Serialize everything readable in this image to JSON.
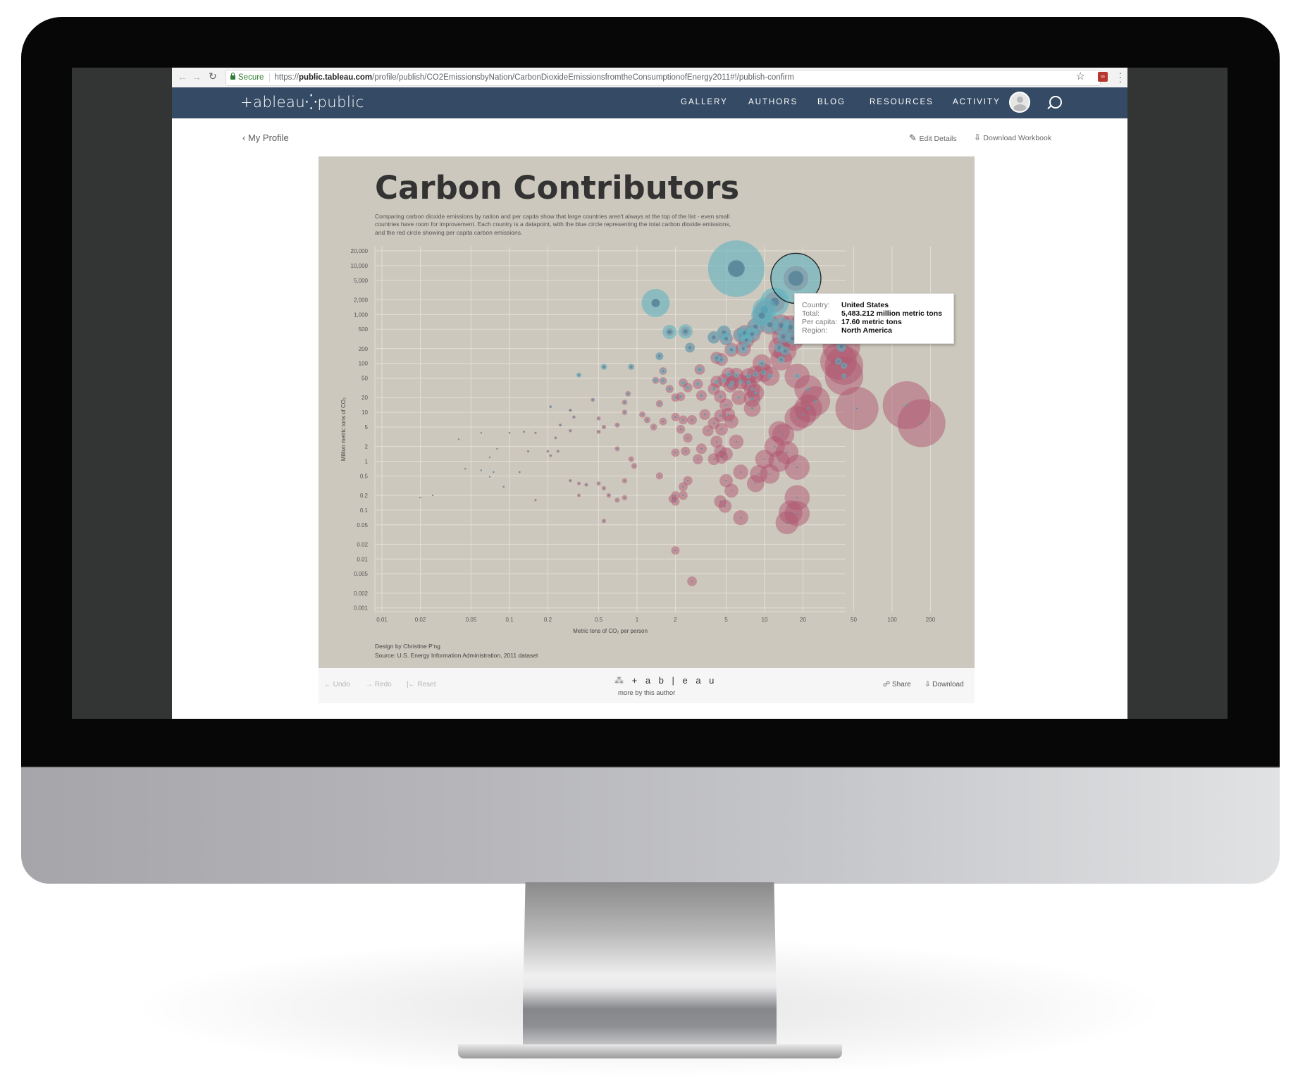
{
  "browser": {
    "secure_label": "Secure",
    "url_scheme": "https://",
    "url_host": "public.tableau.com",
    "url_path": "/profile/publish/CO2EmissionsbyNation/CarbonDioxideEmissionsfromtheConsumptionofEnergy2011#!/publish-confirm"
  },
  "site": {
    "logo": "+ableau⁛public",
    "nav": [
      "GALLERY",
      "AUTHORS",
      "BLOG",
      "RESOURCES",
      "ACTIVITY"
    ]
  },
  "subbar": {
    "back_label": "My Profile",
    "edit_label": "Edit Details",
    "download_workbook_label": "Download Workbook"
  },
  "dashboard": {
    "title": "Carbon Contributors",
    "description": "Comparing carbon dioxide emissions by nation and per capita show that large countries aren't always at the top of the list - even small countries have room for improvement. Each country is a datapoint, with the blue circle representing the total carbon dioxide emissions, and the red circle showing per capita carbon emissions.",
    "credit_design": "Design by Christine P'ng",
    "credit_source": "Source: U.S. Energy Information Administration, 2011 dataset",
    "colors": {
      "total": "#5fb3bf",
      "per_capita": "#b0566f",
      "background": "#ccc8bd"
    }
  },
  "tooltip": {
    "rows": [
      {
        "key": "Country:",
        "value": "United States"
      },
      {
        "key": "Total:",
        "value": "5,483.212 million metric tons"
      },
      {
        "key": "Per capita:",
        "value": "17.60 metric tons"
      },
      {
        "key": "Region:",
        "value": "North America"
      }
    ]
  },
  "toolbar": {
    "undo": "Undo",
    "redo": "Redo",
    "reset": "Reset",
    "logo": "+ a b | e a u",
    "more": "more by this author",
    "share": "Share",
    "download": "Download"
  },
  "chart_data": {
    "type": "scatter",
    "title": "Carbon Contributors",
    "xlabel": "Metric tons of CO₂ per person",
    "ylabel": "Million metric tons of CO₂",
    "xscale": "log",
    "yscale": "log",
    "xlim": [
      0.008,
      300
    ],
    "ylim": [
      0.0008,
      25000
    ],
    "xticks": [
      0.01,
      0.02,
      0.05,
      0.1,
      0.2,
      0.5,
      1,
      2,
      5,
      10,
      20,
      50,
      100,
      200
    ],
    "xtick_labels": [
      "0.01",
      "0.02",
      "0.05",
      "0.1",
      "0.2",
      "0.5",
      "1",
      "2",
      "5",
      "10",
      "20",
      "50",
      "100",
      "200"
    ],
    "yticks": [
      20000,
      10000,
      5000,
      2000,
      1000,
      500,
      200,
      100,
      50,
      20,
      10,
      5,
      2,
      1,
      0.5,
      0.2,
      0.1,
      0.05,
      0.02,
      0.01,
      0.005,
      0.002,
      0.001
    ],
    "ytick_labels": [
      "20,000",
      "10,000",
      "5,000",
      "2,000",
      "1,000",
      "500",
      "200",
      "100",
      "50",
      "20",
      "10",
      "5",
      "2",
      "1",
      "0.5",
      "0.2",
      "0.1",
      "0.05",
      "0.02",
      "0.01",
      "0.005",
      "0.002",
      "0.001"
    ],
    "grid": true,
    "legend": "none",
    "highlighted": {
      "country": "United States",
      "x": 17.6,
      "y": 5483.212
    },
    "points": [
      {
        "x": 6.0,
        "y": 8700
      },
      {
        "x": 17.6,
        "y": 5483
      },
      {
        "x": 1.4,
        "y": 1720
      },
      {
        "x": 12.0,
        "y": 1800
      },
      {
        "x": 10.0,
        "y": 1250
      },
      {
        "x": 9.5,
        "y": 950
      },
      {
        "x": 11.0,
        "y": 620
      },
      {
        "x": 8.5,
        "y": 560
      },
      {
        "x": 13.5,
        "y": 600
      },
      {
        "x": 16.0,
        "y": 550
      },
      {
        "x": 19.0,
        "y": 520
      },
      {
        "x": 1.8,
        "y": 440
      },
      {
        "x": 2.4,
        "y": 450
      },
      {
        "x": 4.8,
        "y": 430
      },
      {
        "x": 6.5,
        "y": 380
      },
      {
        "x": 7.0,
        "y": 420
      },
      {
        "x": 8.0,
        "y": 400
      },
      {
        "x": 4.0,
        "y": 340
      },
      {
        "x": 5.0,
        "y": 320
      },
      {
        "x": 7.2,
        "y": 300
      },
      {
        "x": 14.0,
        "y": 350
      },
      {
        "x": 16.5,
        "y": 320
      },
      {
        "x": 2.6,
        "y": 210
      },
      {
        "x": 5.5,
        "y": 190
      },
      {
        "x": 6.8,
        "y": 200
      },
      {
        "x": 13.0,
        "y": 210
      },
      {
        "x": 14.5,
        "y": 180
      },
      {
        "x": 40.0,
        "y": 220
      },
      {
        "x": 1.5,
        "y": 140
      },
      {
        "x": 4.2,
        "y": 130
      },
      {
        "x": 4.6,
        "y": 120
      },
      {
        "x": 13.5,
        "y": 120
      },
      {
        "x": 38.0,
        "y": 110
      },
      {
        "x": 42.0,
        "y": 90
      },
      {
        "x": 9.5,
        "y": 100
      },
      {
        "x": 0.55,
        "y": 85
      },
      {
        "x": 0.9,
        "y": 85
      },
      {
        "x": 1.6,
        "y": 70
      },
      {
        "x": 3.1,
        "y": 75
      },
      {
        "x": 5.2,
        "y": 60
      },
      {
        "x": 6.0,
        "y": 58
      },
      {
        "x": 7.5,
        "y": 55
      },
      {
        "x": 8.5,
        "y": 60
      },
      {
        "x": 9.8,
        "y": 65
      },
      {
        "x": 11.0,
        "y": 55
      },
      {
        "x": 18.0,
        "y": 55
      },
      {
        "x": 42.0,
        "y": 55
      },
      {
        "x": 0.35,
        "y": 58
      },
      {
        "x": 1.4,
        "y": 45
      },
      {
        "x": 1.6,
        "y": 44
      },
      {
        "x": 2.3,
        "y": 40
      },
      {
        "x": 3.0,
        "y": 38
      },
      {
        "x": 4.2,
        "y": 42
      },
      {
        "x": 4.8,
        "y": 45
      },
      {
        "x": 5.6,
        "y": 40
      },
      {
        "x": 6.5,
        "y": 42
      },
      {
        "x": 7.5,
        "y": 40
      },
      {
        "x": 1.8,
        "y": 30
      },
      {
        "x": 2.5,
        "y": 32
      },
      {
        "x": 4.0,
        "y": 30
      },
      {
        "x": 5.4,
        "y": 35
      },
      {
        "x": 8.0,
        "y": 30
      },
      {
        "x": 8.5,
        "y": 25
      },
      {
        "x": 22.0,
        "y": 30
      },
      {
        "x": 0.85,
        "y": 24
      },
      {
        "x": 2.0,
        "y": 20
      },
      {
        "x": 2.2,
        "y": 21
      },
      {
        "x": 3.2,
        "y": 22
      },
      {
        "x": 4.5,
        "y": 21
      },
      {
        "x": 6.3,
        "y": 20
      },
      {
        "x": 8.0,
        "y": 19
      },
      {
        "x": 25.0,
        "y": 17
      },
      {
        "x": 0.45,
        "y": 18
      },
      {
        "x": 0.8,
        "y": 16
      },
      {
        "x": 1.5,
        "y": 15
      },
      {
        "x": 5.0,
        "y": 14
      },
      {
        "x": 8.0,
        "y": 12
      },
      {
        "x": 22.0,
        "y": 12
      },
      {
        "x": 53.0,
        "y": 12
      },
      {
        "x": 130.0,
        "y": 14
      },
      {
        "x": 0.21,
        "y": 13
      },
      {
        "x": 0.3,
        "y": 11
      },
      {
        "x": 0.8,
        "y": 10
      },
      {
        "x": 1.1,
        "y": 9
      },
      {
        "x": 2.0,
        "y": 8
      },
      {
        "x": 3.4,
        "y": 9
      },
      {
        "x": 4.5,
        "y": 8.5
      },
      {
        "x": 5.2,
        "y": 9
      },
      {
        "x": 20.0,
        "y": 9
      },
      {
        "x": 18.0,
        "y": 7.5
      },
      {
        "x": 0.32,
        "y": 8
      },
      {
        "x": 0.5,
        "y": 7.5
      },
      {
        "x": 1.2,
        "y": 7
      },
      {
        "x": 1.6,
        "y": 6.5
      },
      {
        "x": 2.3,
        "y": 7
      },
      {
        "x": 2.7,
        "y": 7
      },
      {
        "x": 4.0,
        "y": 6
      },
      {
        "x": 5.5,
        "y": 6.5
      },
      {
        "x": 170.0,
        "y": 6
      },
      {
        "x": 0.25,
        "y": 5.5
      },
      {
        "x": 0.55,
        "y": 5
      },
      {
        "x": 0.7,
        "y": 5.5
      },
      {
        "x": 1.35,
        "y": 5
      },
      {
        "x": 2.2,
        "y": 4.5
      },
      {
        "x": 3.6,
        "y": 4.2
      },
      {
        "x": 4.6,
        "y": 4.5
      },
      {
        "x": 13.0,
        "y": 4
      },
      {
        "x": 0.06,
        "y": 3.8
      },
      {
        "x": 0.1,
        "y": 3.8
      },
      {
        "x": 0.13,
        "y": 4
      },
      {
        "x": 0.16,
        "y": 3.8
      },
      {
        "x": 0.5,
        "y": 4
      },
      {
        "x": 0.3,
        "y": 4.2
      },
      {
        "x": 0.23,
        "y": 3
      },
      {
        "x": 2.5,
        "y": 3
      },
      {
        "x": 4.2,
        "y": 2.5
      },
      {
        "x": 6.0,
        "y": 2.5
      },
      {
        "x": 14.0,
        "y": 3.5
      },
      {
        "x": 0.04,
        "y": 2.8
      },
      {
        "x": 0.08,
        "y": 1.8
      },
      {
        "x": 0.14,
        "y": 1.6
      },
      {
        "x": 0.2,
        "y": 1.6
      },
      {
        "x": 0.24,
        "y": 1.6
      },
      {
        "x": 0.7,
        "y": 1.8
      },
      {
        "x": 2.0,
        "y": 1.5
      },
      {
        "x": 2.4,
        "y": 1.6
      },
      {
        "x": 3.2,
        "y": 1.8
      },
      {
        "x": 4.5,
        "y": 1.6
      },
      {
        "x": 5.0,
        "y": 1.4
      },
      {
        "x": 12.0,
        "y": 2
      },
      {
        "x": 15.0,
        "y": 1.5
      },
      {
        "x": 0.07,
        "y": 1.2
      },
      {
        "x": 0.21,
        "y": 1.3
      },
      {
        "x": 0.9,
        "y": 1.1
      },
      {
        "x": 3.0,
        "y": 1.1
      },
      {
        "x": 4.0,
        "y": 1.1
      },
      {
        "x": 4.6,
        "y": 1.2
      },
      {
        "x": 10.0,
        "y": 1.1
      },
      {
        "x": 13.0,
        "y": 1.0
      },
      {
        "x": 0.045,
        "y": 0.7
      },
      {
        "x": 0.06,
        "y": 0.65
      },
      {
        "x": 0.075,
        "y": 0.6
      },
      {
        "x": 0.95,
        "y": 0.8
      },
      {
        "x": 18.0,
        "y": 0.75
      },
      {
        "x": 0.07,
        "y": 0.48
      },
      {
        "x": 0.12,
        "y": 0.6
      },
      {
        "x": 1.5,
        "y": 0.5
      },
      {
        "x": 6.5,
        "y": 0.6
      },
      {
        "x": 9.0,
        "y": 0.55
      },
      {
        "x": 11.0,
        "y": 0.55
      },
      {
        "x": 0.3,
        "y": 0.4
      },
      {
        "x": 0.35,
        "y": 0.35
      },
      {
        "x": 0.4,
        "y": 0.33
      },
      {
        "x": 0.5,
        "y": 0.35
      },
      {
        "x": 0.8,
        "y": 0.4
      },
      {
        "x": 2.5,
        "y": 0.4
      },
      {
        "x": 5.0,
        "y": 0.4
      },
      {
        "x": 0.09,
        "y": 0.3
      },
      {
        "x": 0.55,
        "y": 0.28
      },
      {
        "x": 2.3,
        "y": 0.3
      },
      {
        "x": 5.5,
        "y": 0.25
      },
      {
        "x": 8.5,
        "y": 0.35
      },
      {
        "x": 0.35,
        "y": 0.2
      },
      {
        "x": 2.0,
        "y": 0.2
      },
      {
        "x": 0.6,
        "y": 0.2
      },
      {
        "x": 0.8,
        "y": 0.18
      },
      {
        "x": 1.9,
        "y": 0.17
      },
      {
        "x": 0.16,
        "y": 0.16
      },
      {
        "x": 2.3,
        "y": 0.2
      },
      {
        "x": 4.5,
        "y": 0.15
      },
      {
        "x": 18.0,
        "y": 0.18
      },
      {
        "x": 0.02,
        "y": 0.18
      },
      {
        "x": 0.025,
        "y": 0.2
      },
      {
        "x": 0.7,
        "y": 0.16
      },
      {
        "x": 2.0,
        "y": 0.15
      },
      {
        "x": 4.9,
        "y": 0.12
      },
      {
        "x": 16.0,
        "y": 0.09
      },
      {
        "x": 18.0,
        "y": 0.085
      },
      {
        "x": 0.55,
        "y": 0.06
      },
      {
        "x": 6.5,
        "y": 0.07
      },
      {
        "x": 15.0,
        "y": 0.055
      },
      {
        "x": 2.0,
        "y": 0.015
      },
      {
        "x": 2.7,
        "y": 0.0035
      }
    ]
  }
}
